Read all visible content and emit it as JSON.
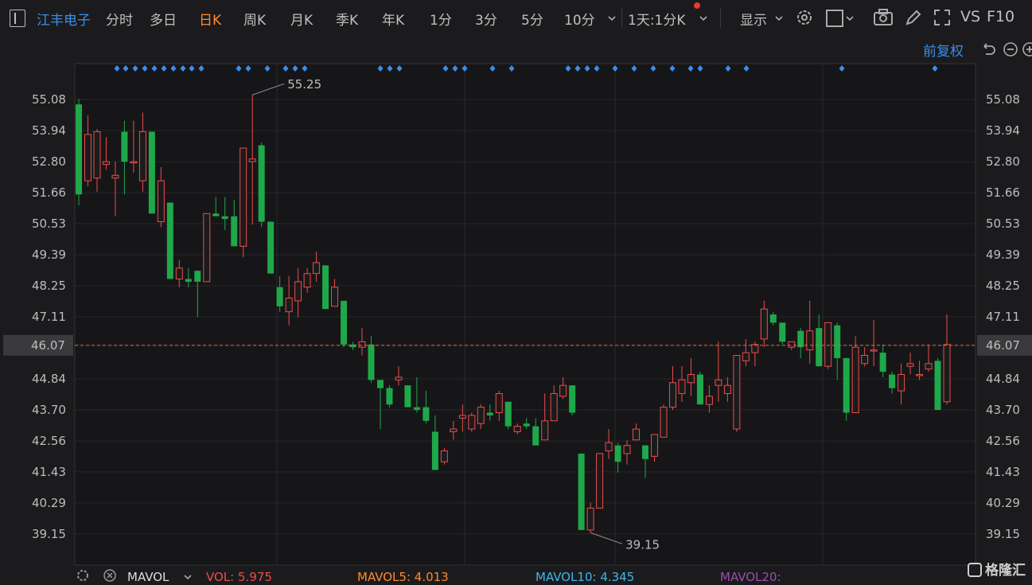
{
  "toolbar": {
    "stock_name": "江丰电子",
    "periods": [
      "分时",
      "多日",
      "日K",
      "周K",
      "月K",
      "季K",
      "年K",
      "1分",
      "3分",
      "5分",
      "10分"
    ],
    "active_period": "日K",
    "combo_label": "1天:1分K",
    "display_label": "显示",
    "vs_label": "VS",
    "f10_label": "F10"
  },
  "adjust_label": "前复权",
  "current_price": "46.07",
  "price_axis_labels": [
    "55.08",
    "53.94",
    "52.80",
    "51.66",
    "50.53",
    "49.39",
    "48.25",
    "47.11",
    "46.07",
    "44.84",
    "43.70",
    "42.56",
    "41.43",
    "40.29",
    "39.15"
  ],
  "annotations": {
    "high": "55.25",
    "low": "39.15"
  },
  "bottom": {
    "indicator": "MAVOL",
    "vol": "VOL: 5.975",
    "mavol5": "MAVOL5: 4.013",
    "mavol10": "MAVOL10: 4.345",
    "mavol20": "MAVOL20:"
  },
  "watermark": "格隆汇",
  "colors": {
    "up": "#ef4b4b",
    "down": "#1fa84a",
    "accent": "#3b8eea",
    "active": "#ff8a2b",
    "price_line": "#e0703c"
  },
  "chart_data": {
    "type": "candlestick",
    "ylim": [
      38.5,
      55.7
    ],
    "candles": [
      {
        "o": 54.9,
        "h": 55.1,
        "l": 51.2,
        "c": 51.6
      },
      {
        "o": 52.1,
        "h": 54.5,
        "l": 51.9,
        "c": 53.8
      },
      {
        "o": 52.2,
        "h": 54.0,
        "l": 51.7,
        "c": 53.9
      },
      {
        "o": 52.7,
        "h": 53.7,
        "l": 52.5,
        "c": 52.8
      },
      {
        "o": 52.2,
        "h": 52.8,
        "l": 50.8,
        "c": 52.3
      },
      {
        "o": 53.9,
        "h": 54.3,
        "l": 51.6,
        "c": 52.8
      },
      {
        "o": 52.8,
        "h": 54.3,
        "l": 52.4,
        "c": 52.8
      },
      {
        "o": 52.1,
        "h": 54.6,
        "l": 51.7,
        "c": 53.9
      },
      {
        "o": 53.9,
        "h": 53.9,
        "l": 50.9,
        "c": 50.9
      },
      {
        "o": 50.6,
        "h": 52.6,
        "l": 50.4,
        "c": 52.1
      },
      {
        "o": 51.3,
        "h": 51.3,
        "l": 48.5,
        "c": 48.5
      },
      {
        "o": 48.5,
        "h": 49.2,
        "l": 48.2,
        "c": 48.9
      },
      {
        "o": 48.5,
        "h": 48.9,
        "l": 48.2,
        "c": 48.4
      },
      {
        "o": 48.8,
        "h": 48.8,
        "l": 47.1,
        "c": 48.4
      },
      {
        "o": 48.4,
        "h": 50.9,
        "l": 48.4,
        "c": 50.9
      },
      {
        "o": 50.9,
        "h": 51.5,
        "l": 50.8,
        "c": 50.8
      },
      {
        "o": 50.8,
        "h": 51.5,
        "l": 50.3,
        "c": 50.7
      },
      {
        "o": 50.8,
        "h": 51.4,
        "l": 49.8,
        "c": 49.7
      },
      {
        "o": 49.7,
        "h": 52.9,
        "l": 49.3,
        "c": 53.3
      },
      {
        "o": 52.8,
        "h": 55.25,
        "l": 50.5,
        "c": 52.9
      },
      {
        "o": 53.4,
        "h": 53.5,
        "l": 50.4,
        "c": 50.6
      },
      {
        "o": 50.6,
        "h": 50.6,
        "l": 48.7,
        "c": 48.7
      },
      {
        "o": 48.2,
        "h": 48.6,
        "l": 47.3,
        "c": 47.5
      },
      {
        "o": 47.3,
        "h": 48.6,
        "l": 46.8,
        "c": 47.8
      },
      {
        "o": 47.7,
        "h": 48.9,
        "l": 47.1,
        "c": 48.4
      },
      {
        "o": 48.2,
        "h": 48.9,
        "l": 48.0,
        "c": 48.7
      },
      {
        "o": 48.7,
        "h": 49.5,
        "l": 48.4,
        "c": 49.1
      },
      {
        "o": 49.0,
        "h": 49.0,
        "l": 47.4,
        "c": 47.4
      },
      {
        "o": 47.5,
        "h": 48.5,
        "l": 47.5,
        "c": 48.2
      },
      {
        "o": 47.7,
        "h": 47.7,
        "l": 46.0,
        "c": 46.1
      },
      {
        "o": 46.1,
        "h": 46.2,
        "l": 45.9,
        "c": 46.0
      },
      {
        "o": 46.0,
        "h": 46.7,
        "l": 45.7,
        "c": 46.2
      },
      {
        "o": 46.1,
        "h": 46.4,
        "l": 44.7,
        "c": 44.8
      },
      {
        "o": 44.8,
        "h": 44.8,
        "l": 43.0,
        "c": 44.5
      },
      {
        "o": 44.5,
        "h": 44.6,
        "l": 43.8,
        "c": 43.9
      },
      {
        "o": 44.8,
        "h": 45.3,
        "l": 44.6,
        "c": 44.9
      },
      {
        "o": 44.6,
        "h": 44.6,
        "l": 43.8,
        "c": 43.8
      },
      {
        "o": 43.8,
        "h": 44.9,
        "l": 43.6,
        "c": 43.7
      },
      {
        "o": 43.8,
        "h": 44.4,
        "l": 43.2,
        "c": 43.3
      },
      {
        "o": 42.9,
        "h": 43.5,
        "l": 41.5,
        "c": 41.5
      },
      {
        "o": 41.8,
        "h": 42.3,
        "l": 41.7,
        "c": 42.2
      },
      {
        "o": 42.9,
        "h": 43.3,
        "l": 42.6,
        "c": 43.0
      },
      {
        "o": 43.4,
        "h": 43.9,
        "l": 42.9,
        "c": 43.5
      },
      {
        "o": 43.0,
        "h": 43.6,
        "l": 42.9,
        "c": 43.5
      },
      {
        "o": 43.2,
        "h": 43.9,
        "l": 43.0,
        "c": 43.8
      },
      {
        "o": 43.6,
        "h": 43.9,
        "l": 43.3,
        "c": 43.5
      },
      {
        "o": 43.6,
        "h": 44.4,
        "l": 43.3,
        "c": 44.3
      },
      {
        "o": 44.0,
        "h": 44.0,
        "l": 43.0,
        "c": 43.1
      },
      {
        "o": 42.9,
        "h": 43.2,
        "l": 42.8,
        "c": 43.1
      },
      {
        "o": 43.2,
        "h": 43.4,
        "l": 43.0,
        "c": 43.1
      },
      {
        "o": 43.1,
        "h": 43.4,
        "l": 42.4,
        "c": 42.4
      },
      {
        "o": 42.6,
        "h": 44.3,
        "l": 42.6,
        "c": 43.3
      },
      {
        "o": 43.3,
        "h": 44.6,
        "l": 43.3,
        "c": 44.3
      },
      {
        "o": 44.2,
        "h": 44.9,
        "l": 44.1,
        "c": 44.6
      },
      {
        "o": 44.6,
        "h": 44.6,
        "l": 43.5,
        "c": 43.6
      },
      {
        "o": 42.1,
        "h": 42.1,
        "l": 39.3,
        "c": 39.3
      },
      {
        "o": 39.3,
        "h": 40.3,
        "l": 39.2,
        "c": 40.1
      },
      {
        "o": 40.1,
        "h": 42.1,
        "l": 40.1,
        "c": 42.1
      },
      {
        "o": 42.2,
        "h": 43.0,
        "l": 41.9,
        "c": 42.5
      },
      {
        "o": 42.4,
        "h": 42.5,
        "l": 41.4,
        "c": 41.8
      },
      {
        "o": 42.1,
        "h": 42.6,
        "l": 41.7,
        "c": 42.4
      },
      {
        "o": 42.6,
        "h": 43.2,
        "l": 42.6,
        "c": 43.0
      },
      {
        "o": 42.4,
        "h": 42.4,
        "l": 41.2,
        "c": 41.9
      },
      {
        "o": 42.0,
        "h": 42.8,
        "l": 41.8,
        "c": 42.8
      },
      {
        "o": 42.7,
        "h": 43.9,
        "l": 42.7,
        "c": 43.8
      },
      {
        "o": 43.8,
        "h": 45.3,
        "l": 43.7,
        "c": 44.7
      },
      {
        "o": 44.3,
        "h": 45.3,
        "l": 44.0,
        "c": 44.8
      },
      {
        "o": 44.7,
        "h": 45.6,
        "l": 44.2,
        "c": 45.0
      },
      {
        "o": 45.0,
        "h": 45.1,
        "l": 43.9,
        "c": 43.9
      },
      {
        "o": 43.9,
        "h": 44.6,
        "l": 43.6,
        "c": 44.2
      },
      {
        "o": 44.6,
        "h": 46.2,
        "l": 44.0,
        "c": 44.8
      },
      {
        "o": 44.3,
        "h": 44.9,
        "l": 44.0,
        "c": 44.6
      },
      {
        "o": 43.0,
        "h": 45.7,
        "l": 42.9,
        "c": 45.7
      },
      {
        "o": 45.5,
        "h": 46.3,
        "l": 45.3,
        "c": 45.8
      },
      {
        "o": 45.8,
        "h": 46.2,
        "l": 45.3,
        "c": 46.1
      },
      {
        "o": 46.3,
        "h": 47.7,
        "l": 46.0,
        "c": 47.4
      },
      {
        "o": 47.2,
        "h": 47.3,
        "l": 46.8,
        "c": 46.9
      },
      {
        "o": 46.9,
        "h": 46.9,
        "l": 46.1,
        "c": 46.2
      },
      {
        "o": 46.0,
        "h": 46.2,
        "l": 45.9,
        "c": 46.2
      },
      {
        "o": 46.6,
        "h": 46.7,
        "l": 45.6,
        "c": 46.0
      },
      {
        "o": 45.9,
        "h": 47.7,
        "l": 45.4,
        "c": 46.6
      },
      {
        "o": 46.7,
        "h": 47.2,
        "l": 45.3,
        "c": 45.3
      },
      {
        "o": 45.3,
        "h": 46.5,
        "l": 45.2,
        "c": 46.9
      },
      {
        "o": 46.8,
        "h": 46.9,
        "l": 44.8,
        "c": 45.6
      },
      {
        "o": 45.6,
        "h": 45.6,
        "l": 43.3,
        "c": 43.6
      },
      {
        "o": 43.6,
        "h": 46.4,
        "l": 43.6,
        "c": 46.0
      },
      {
        "o": 45.4,
        "h": 46.0,
        "l": 45.3,
        "c": 45.7
      },
      {
        "o": 45.9,
        "h": 47.0,
        "l": 45.3,
        "c": 45.9
      },
      {
        "o": 45.8,
        "h": 46.1,
        "l": 44.9,
        "c": 45.1
      },
      {
        "o": 45.0,
        "h": 45.1,
        "l": 44.3,
        "c": 44.5
      },
      {
        "o": 44.4,
        "h": 45.4,
        "l": 43.9,
        "c": 45.0
      },
      {
        "o": 45.3,
        "h": 45.8,
        "l": 45.0,
        "c": 45.4
      },
      {
        "o": 45.0,
        "h": 45.5,
        "l": 44.8,
        "c": 45.0
      },
      {
        "o": 45.2,
        "h": 46.1,
        "l": 45.1,
        "c": 45.4
      },
      {
        "o": 45.5,
        "h": 45.6,
        "l": 43.7,
        "c": 43.7
      },
      {
        "o": 44.0,
        "h": 47.2,
        "l": 43.9,
        "c": 46.1
      }
    ]
  }
}
